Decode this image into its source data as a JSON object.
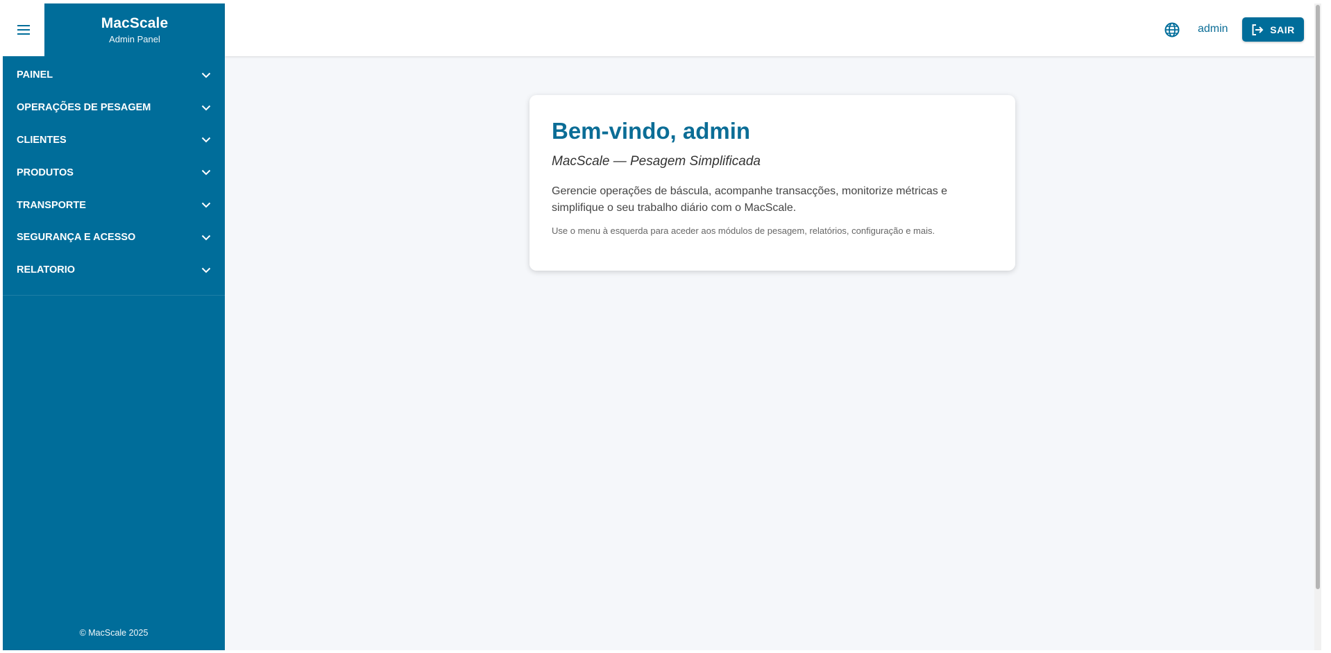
{
  "brand": {
    "name": "MacScale",
    "subtitle": "Admin Panel"
  },
  "sidebar": {
    "items": [
      {
        "label": "PAINEL"
      },
      {
        "label": "OPERAÇÕES DE PESAGEM"
      },
      {
        "label": "CLIENTES"
      },
      {
        "label": "PRODUTOS"
      },
      {
        "label": "TRANSPORTE"
      },
      {
        "label": "SEGURANÇA E ACESSO"
      },
      {
        "label": "RELATORIO"
      }
    ],
    "footer": "© MacScale 2025"
  },
  "header": {
    "language_icon": "globe-icon",
    "user": "admin",
    "logout_label": "SAIR"
  },
  "welcome": {
    "title": "Bem-vindo, admin",
    "subtitle": "MacScale — Pesagem Simplificada",
    "body": "Gerencie operações de báscula, acompanhe transacções, monitorize métricas e simplifique o seu trabalho diário com o MacScale.",
    "hint": "Use o menu à esquerda para aceder aos módulos de pesagem, relatórios, configuração e mais."
  },
  "colors": {
    "primary": "#006d9a",
    "page_background": "#f5f7fa"
  }
}
